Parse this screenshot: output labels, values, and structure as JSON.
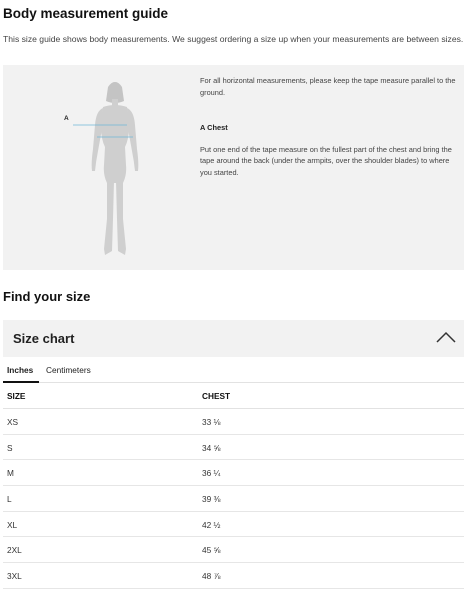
{
  "guide": {
    "title": "Body measurement guide",
    "intro": "This size guide shows body measurements. We suggest ordering a size up when your measurements are between sizes.",
    "marker": "A",
    "horizontal_note": "For all horizontal measurements, please keep the tape measure parallel to the ground.",
    "chest_heading": "A Chest",
    "chest_instructions": "Put one end of the tape measure on the fullest part of the chest and bring the tape around the back (under the armpits, over the shoulder blades) to where you started."
  },
  "find_size": {
    "title": "Find your size"
  },
  "size_chart": {
    "title": "Size chart",
    "toggle_icon": "chevron-up-icon",
    "tabs": [
      {
        "label": "Inches",
        "active": true
      },
      {
        "label": "Centimeters",
        "active": false
      }
    ],
    "columns": [
      "SIZE",
      "CHEST"
    ],
    "rows": [
      [
        "XS",
        "33 ⅛"
      ],
      [
        "S",
        "34 ⅝"
      ],
      [
        "M",
        "36 ¼"
      ],
      [
        "L",
        "39 ⅜"
      ],
      [
        "XL",
        "42 ½"
      ],
      [
        "2XL",
        "45 ⅝"
      ],
      [
        "3XL",
        "48 ⅞"
      ]
    ]
  },
  "colors": {
    "panel_bg": "#f2f2f2",
    "figure": "#cfcfcf",
    "tape_line": "#6fb6d9"
  }
}
